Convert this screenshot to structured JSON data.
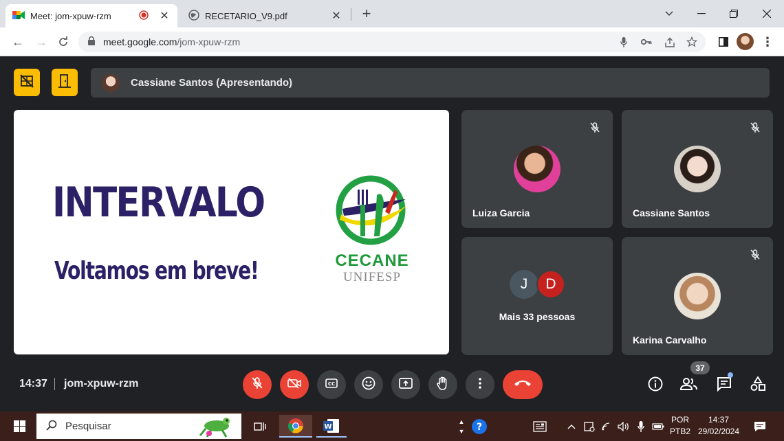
{
  "browser": {
    "tabs": [
      {
        "title": "Meet: jom-xpuw-rzm",
        "active": true,
        "recording": true
      },
      {
        "title": "RECETARIO_V9.pdf",
        "active": false
      }
    ],
    "url_domain": "meet.google.com",
    "url_path": "/jom-xpuw-rzm"
  },
  "meet": {
    "presenter_label": "Cassiane Santos (Apresentando)",
    "slide": {
      "title": "INTERVALO",
      "subtitle": "Voltamos em breve!",
      "logo_name": "CECANE",
      "logo_sub": "UNIFESP"
    },
    "participants": [
      {
        "name": "Luiza Garcia",
        "muted": false
      },
      {
        "name": "Cassiane Santos",
        "muted": true
      },
      {
        "name": "Karina Carvalho",
        "muted": true
      }
    ],
    "more": {
      "initials": [
        "J",
        "D"
      ],
      "label": "Mais 33 pessoas"
    },
    "time": "14:37",
    "meeting_code": "jom-xpuw-rzm",
    "people_count": "37"
  },
  "taskbar": {
    "search_placeholder": "Pesquisar",
    "lang_line1": "POR",
    "lang_line2": "PTB2",
    "clock_time": "14:37",
    "clock_date": "29/02/2024"
  },
  "colors": {
    "accent_yellow": "#fbbc04",
    "danger_red": "#ea4335",
    "meet_bg": "#202124",
    "tile_bg": "#3c4043",
    "slide_text": "#2c2166",
    "logo_green": "#1f9a3a"
  }
}
